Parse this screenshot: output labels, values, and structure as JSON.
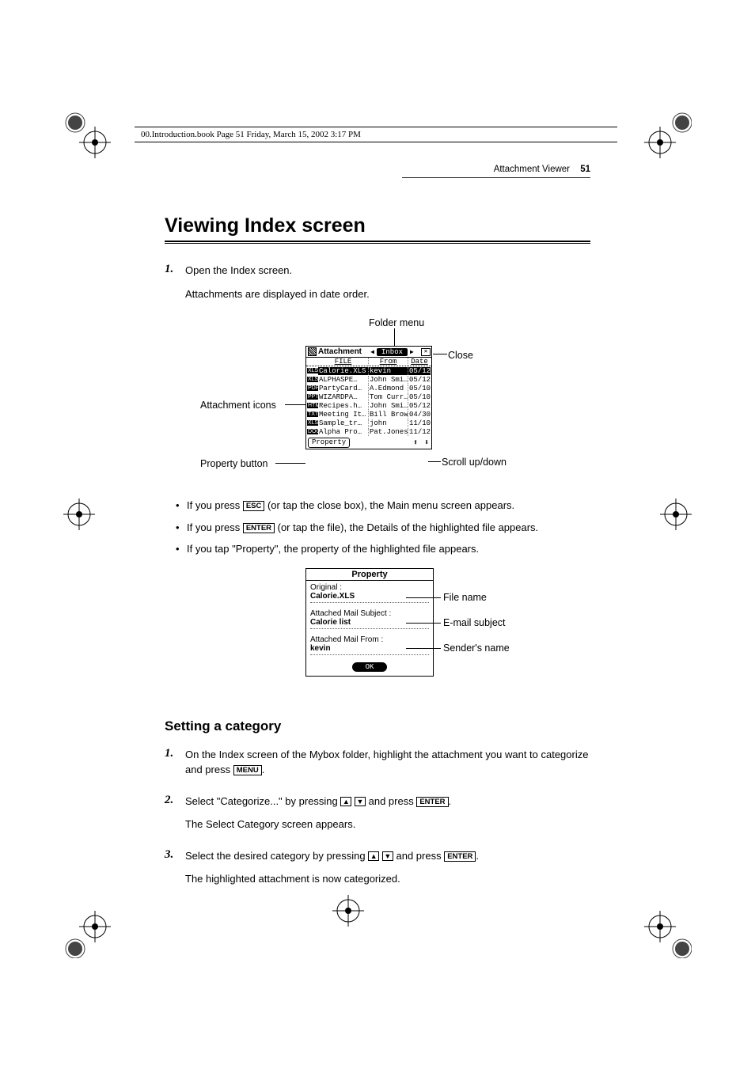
{
  "header_line": "00.Introduction.book  Page 51  Friday, March 15, 2002  3:17 PM",
  "running_head": {
    "text": "Attachment Viewer",
    "page": "51"
  },
  "section_title": "Viewing Index screen",
  "step1_num": "1.",
  "step1_text": "Open the Index screen.",
  "step1_note": "Attachments are displayed in date order.",
  "fig1": {
    "callouts": {
      "folder_menu": "Folder menu",
      "close": "Close",
      "attachment_icons": "Attachment icons",
      "property_button": "Property button",
      "scroll": "Scroll up/down"
    },
    "app": {
      "title": "Attachment",
      "folder": "Inbox",
      "close_glyph": "✕",
      "left_tri": "◀",
      "right_tri": "▶",
      "columns": {
        "file": "FILE",
        "from": "From",
        "date": "Date"
      },
      "rows": [
        {
          "icon": "XLS",
          "file": "Calorie.XLS",
          "from": "kevin",
          "date": "05/12",
          "selected": true
        },
        {
          "icon": "XLS",
          "file": "ALPHASPE…",
          "from": "John Smi…",
          "date": "05/12",
          "selected": false
        },
        {
          "icon": "PDF",
          "file": "PartyCard…",
          "from": "A.Edmond",
          "date": "05/10",
          "selected": false
        },
        {
          "icon": "PPT",
          "file": "WIZARDPA…",
          "from": "Tom Curr…",
          "date": "05/10",
          "selected": false
        },
        {
          "icon": "HTM",
          "file": "Recipes.h…",
          "from": "John Smi…",
          "date": "05/12",
          "selected": false
        },
        {
          "icon": "TXT",
          "file": "Meeting It…",
          "from": "Bill Brown",
          "date": "04/30",
          "selected": false
        },
        {
          "icon": "XLS",
          "file": "Sample_tr…",
          "from": "john",
          "date": "11/10",
          "selected": false
        },
        {
          "icon": "DOC",
          "file": "Alpha Pro…",
          "from": "Pat.Jones",
          "date": "11/12",
          "selected": false
        }
      ],
      "property_btn": "Property",
      "updown": "⬆ ⬇"
    }
  },
  "bullets": [
    {
      "pre": "If you press ",
      "key": "ESC",
      "post": " (or tap the close box), the Main menu screen appears."
    },
    {
      "pre": "If you press ",
      "key": "ENTER",
      "post": " (or tap the file), the Details of the highlighted file appears."
    },
    {
      "plain": "If you tap \"Property\", the property of the highlighted file appears."
    }
  ],
  "fig2": {
    "dialog_title": "Property",
    "rows": [
      {
        "label": "Original :",
        "value": "Calorie.XLS",
        "callout": "File name"
      },
      {
        "label": "Attached Mail Subject :",
        "value": "Calorie list",
        "callout": "E-mail subject"
      },
      {
        "label": "Attached Mail From :",
        "value": "kevin",
        "callout": "Sender's name"
      }
    ],
    "ok": "OK"
  },
  "subhead": "Setting a category",
  "cat_steps": {
    "s1_num": "1.",
    "s1a": "On the Index screen of the Mybox folder, highlight the attachment you want to categorize and press ",
    "s1_key": "MENU",
    "s1b": ".",
    "s2_num": "2.",
    "s2a": "Select \"Categorize...\" by pressing ",
    "s2_up": "▲",
    "s2_down": "▼",
    "s2b": " and press ",
    "s2_key": "ENTER",
    "s2c": ".",
    "s2_note": "The Select Category screen appears.",
    "s3_num": "3.",
    "s3a": "Select the desired category by pressing ",
    "s3_up": "▲",
    "s3_down": "▼",
    "s3b": " and press ",
    "s3_key": "ENTER",
    "s3c": ".",
    "s3_note": "The highlighted attachment is now categorized."
  }
}
